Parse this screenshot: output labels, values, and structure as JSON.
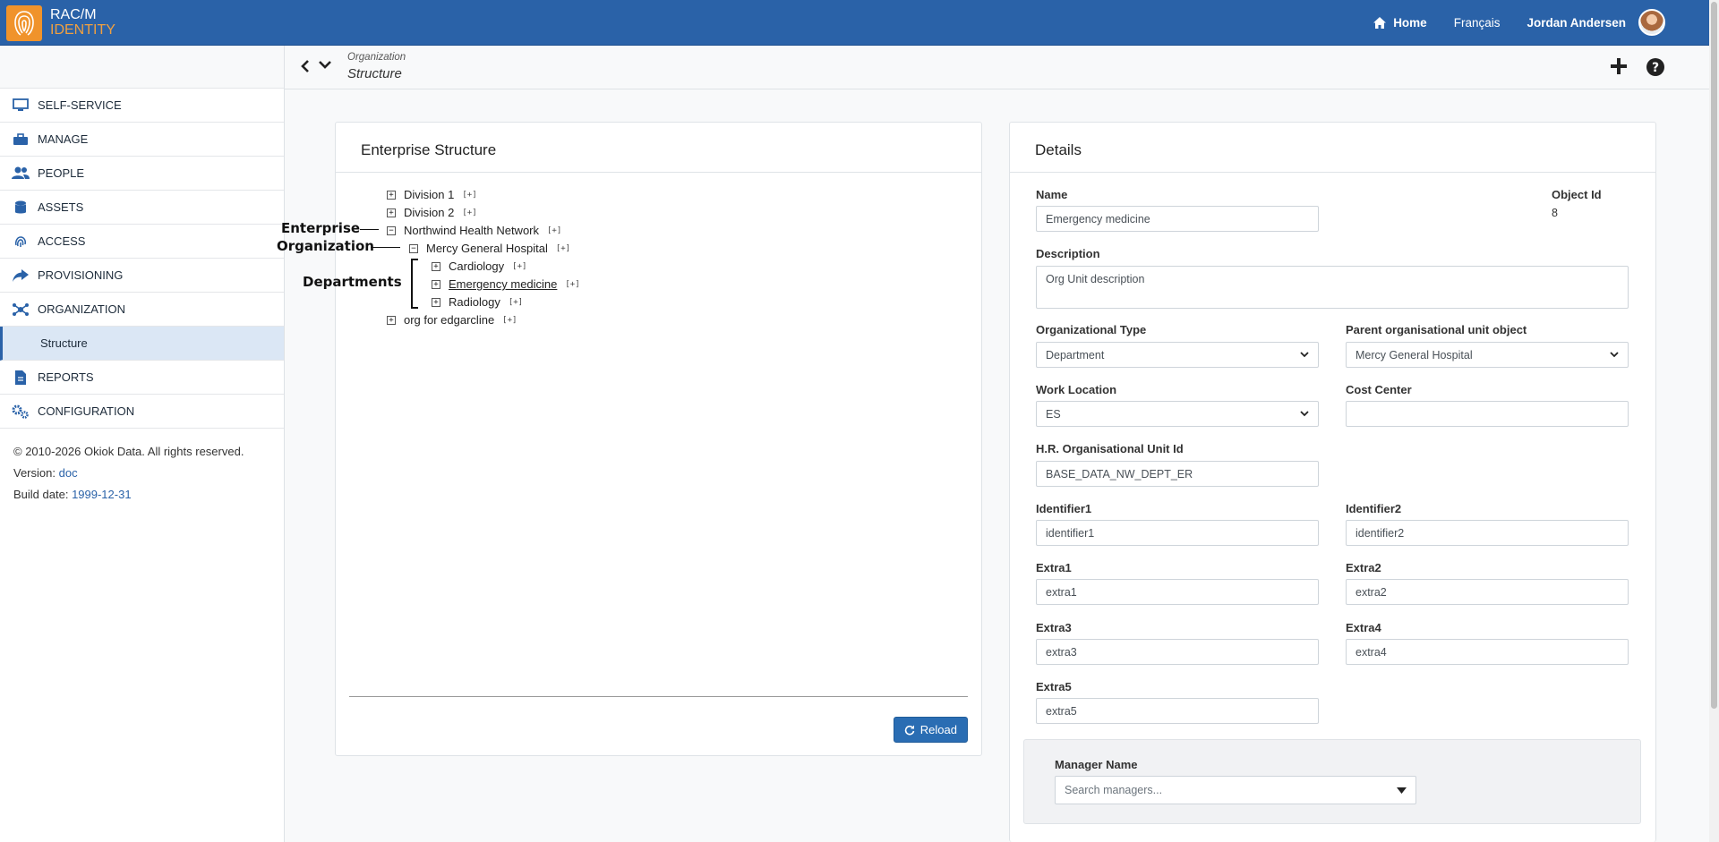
{
  "brand": {
    "line1": "RAC/M",
    "line2": "IDENTITY"
  },
  "topnav": {
    "home": "Home",
    "language": "Français",
    "user": "Jordan Andersen"
  },
  "breadcrumb": {
    "section": "Organization",
    "page": "Structure"
  },
  "sidebar": {
    "items": [
      {
        "label": "SELF-SERVICE",
        "icon": "monitor-icon"
      },
      {
        "label": "MANAGE",
        "icon": "briefcase-icon"
      },
      {
        "label": "PEOPLE",
        "icon": "users-icon"
      },
      {
        "label": "ASSETS",
        "icon": "database-icon"
      },
      {
        "label": "ACCESS",
        "icon": "fingerprint-icon"
      },
      {
        "label": "PROVISIONING",
        "icon": "share-icon"
      },
      {
        "label": "ORGANIZATION",
        "icon": "network-icon"
      },
      {
        "label": "Structure",
        "icon": ""
      },
      {
        "label": "REPORTS",
        "icon": "file-icon"
      },
      {
        "label": "CONFIGURATION",
        "icon": "cogs-icon"
      }
    ],
    "footer": {
      "copyright": "© 2010-2026 Okiok Data. All rights reserved.",
      "version_label": "Version:",
      "version_value": "doc",
      "build_label": "Build date:",
      "build_value": "1999-12-31"
    }
  },
  "structure": {
    "title": "Enterprise Structure",
    "nodes": [
      {
        "label": "Division 1",
        "toggle": "+",
        "add": "[+]"
      },
      {
        "label": "Division 2",
        "toggle": "+",
        "add": "[+]"
      },
      {
        "label": "Northwind Health Network",
        "toggle": "−",
        "add": "[+]"
      },
      {
        "label": "Mercy General Hospital",
        "toggle": "−",
        "add": "[+]"
      },
      {
        "label": "Cardiology",
        "toggle": "+",
        "add": "[+]"
      },
      {
        "label": "Emergency medicine",
        "toggle": "+",
        "add": "[+]"
      },
      {
        "label": "Radiology",
        "toggle": "+",
        "add": "[+]"
      },
      {
        "label": "org for edgarcline",
        "toggle": "+",
        "add": "[+]"
      }
    ],
    "annotations": {
      "enterprise": "Enterprise",
      "organization": "Organization",
      "departments": "Departments"
    },
    "reload_label": "Reload"
  },
  "details": {
    "title": "Details",
    "name_label": "Name",
    "name_value": "Emergency medicine",
    "objectid_label": "Object Id",
    "objectid_value": "8",
    "description_label": "Description",
    "description_value": "Org Unit description",
    "orgtype_label": "Organizational Type",
    "orgtype_value": "Department",
    "parent_label": "Parent organisational unit object",
    "parent_value": "Mercy General Hospital",
    "worklocation_label": "Work Location",
    "worklocation_value": "ES",
    "costcenter_label": "Cost Center",
    "costcenter_value": "",
    "hrid_label": "H.R. Organisational Unit Id",
    "hrid_value": "BASE_DATA_NW_DEPT_ER",
    "identifier1_label": "Identifier1",
    "identifier1_value": "identifier1",
    "identifier2_label": "Identifier2",
    "identifier2_value": "identifier2",
    "extra1_label": "Extra1",
    "extra1_value": "extra1",
    "extra2_label": "Extra2",
    "extra2_value": "extra2",
    "extra3_label": "Extra3",
    "extra3_value": "extra3",
    "extra4_label": "Extra4",
    "extra4_value": "extra4",
    "extra5_label": "Extra5",
    "extra5_value": "extra5",
    "manager_label": "Manager Name",
    "manager_placeholder": "Search managers..."
  },
  "colors": {
    "primary": "#2a62a8",
    "brand_orange": "#f0932b",
    "active_bg": "#dbe7f5"
  }
}
